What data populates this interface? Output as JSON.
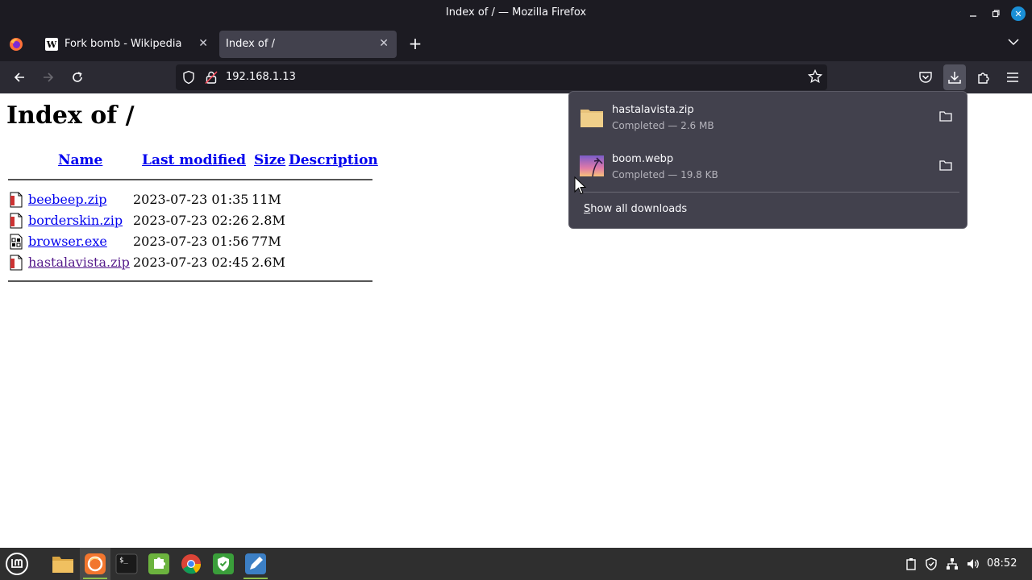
{
  "window": {
    "title": "Index of / — Mozilla Firefox"
  },
  "tabs": [
    {
      "label": "Fork bomb - Wikipedia",
      "favicon": "W"
    },
    {
      "label": "Index of /"
    }
  ],
  "urlbar": {
    "url": "192.168.1.13"
  },
  "page": {
    "heading": "Index of /",
    "columns": [
      "Name",
      "Last modified",
      "Size",
      "Description"
    ],
    "rows": [
      {
        "name": "beebeep.zip",
        "modified": "2023-07-23 01:35",
        "size": "11M",
        "icon": "compressed-icon"
      },
      {
        "name": "borderskin.zip",
        "modified": "2023-07-23 02:26",
        "size": "2.8M",
        "icon": "compressed-icon"
      },
      {
        "name": "browser.exe",
        "modified": "2023-07-23 01:56",
        "size": "77M",
        "icon": "binary-icon"
      },
      {
        "name": "hastalavista.zip",
        "modified": "2023-07-23 02:45",
        "size": "2.6M",
        "icon": "compressed-icon"
      }
    ]
  },
  "downloads": {
    "items": [
      {
        "filename": "hastalavista.zip",
        "status": "Completed — 2.6 MB"
      },
      {
        "filename": "boom.webp",
        "status": "Completed — 19.8 KB"
      }
    ],
    "show_all_prefix": "S",
    "show_all_rest": "how all downloads"
  },
  "taskbar": {
    "clock": "08:52"
  },
  "colors": {
    "link": "#0000ee",
    "visited": "#551a8b",
    "panel": "#42414d",
    "accent": "#1a8fd6"
  }
}
